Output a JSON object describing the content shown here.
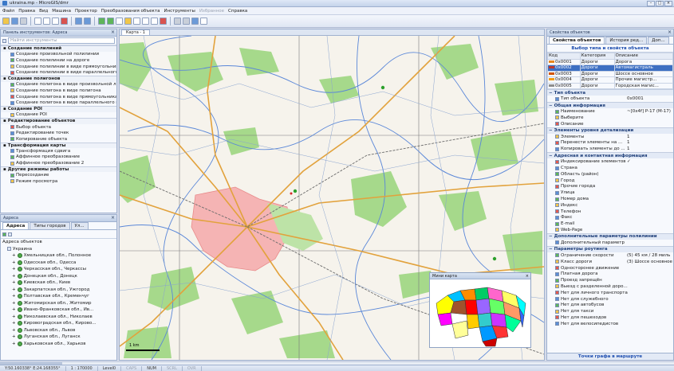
{
  "window": {
    "title": "ukraina.mp - MicroGIS/dmr",
    "buttons": [
      "–",
      "□",
      "×"
    ]
  },
  "menu": [
    {
      "label": "Файл",
      "disabled": false
    },
    {
      "label": "Правка",
      "disabled": false
    },
    {
      "label": "Вид",
      "disabled": false
    },
    {
      "label": "Машина",
      "disabled": false
    },
    {
      "label": "Проектор",
      "disabled": false
    },
    {
      "label": "Преобразования объекта",
      "disabled": false
    },
    {
      "label": "Инструменты",
      "disabled": false
    },
    {
      "label": "Избранное",
      "disabled": true
    },
    {
      "label": "Справка",
      "disabled": false
    }
  ],
  "left_panel": {
    "header": "Панель инструментов: Адреса",
    "search_placeholder": "Найти инструменты",
    "sections": [
      {
        "title": "Создание полилиний",
        "items": [
          "Создание произвольной полилинии",
          "Создание полилинии на дороге",
          "Создание полилинии в виде прямоугольника",
          "Создание полилинии в виде параллельного прям..."
        ]
      },
      {
        "title": "Создание полигонов",
        "items": [
          "Создание полигона в виде произвольной линии",
          "Создание полигона в виде полигона",
          "Создание полигона в виде прямоугольника",
          "Создание полигона в виде параллельного пря..."
        ]
      },
      {
        "title": "Создание POI",
        "items": [
          "Создание POI"
        ]
      },
      {
        "title": "Редактирование объектов",
        "items": [
          "Выбор объекта",
          "Редактирование точек",
          "Копирование объекта"
        ]
      },
      {
        "title": "Трансформация карты",
        "items": [
          "Трансформация сдвига",
          "Аффинное преобразование",
          "Аффинное преобразование 2"
        ]
      },
      {
        "title": "Другие режимы работы",
        "items": [
          "Пересоздание",
          "Режим просмотра"
        ]
      }
    ]
  },
  "address_panel": {
    "header": "Адреса",
    "tabs": [
      "Адреса",
      "Типы городов",
      "Ул..."
    ],
    "tree_root": "Адреса объектов",
    "tree_sub": "Украина",
    "regions": [
      "Хмельницкая обл., Полонное",
      "Одесская обл., Одесса",
      "Черкасская обл., Черкассы",
      "Донецкая обл., Донецк",
      "Киевская обл., Киев",
      "Закарпатская обл., Ужгород",
      "Полтавская обл., Кременчуг",
      "Житомирская обл., Житомир",
      "Ивано-Франковская обл., Ив...",
      "Николаевская обл., Николаев",
      "Кировоградская обл., Кирово...",
      "Львовская обл., Львов",
      "Луганская обл., Луганск",
      "Харьковская обл., Харьков"
    ]
  },
  "map": {
    "tab": "Карта - 1",
    "scale_label": "1 km",
    "minimap_title": "Мини карта"
  },
  "right_panel": {
    "tabs": [
      "Свойства объектов",
      "История ред...",
      "Доп..."
    ],
    "title": "Выбор типа и свойств объекта",
    "columns": [
      "Код",
      "Категория",
      "Описание"
    ],
    "rows": [
      {
        "code": "0x0001",
        "category": "Дороги",
        "desc": "Дорога",
        "color": "#e8871e",
        "sel": false
      },
      {
        "code": "0x0002",
        "category": "Дороги",
        "desc": "Автомагистраль",
        "color": "#c0392b",
        "sel": true
      },
      {
        "code": "0x0003",
        "category": "Дороги",
        "desc": "Шоссе основное",
        "color": "#d35400",
        "sel": false
      },
      {
        "code": "0x0004",
        "category": "Дороги",
        "desc": "Прочие магистр...",
        "color": "#f39c12",
        "sel": false
      },
      {
        "code": "0x0005",
        "category": "Дороги",
        "desc": "Городская магис...",
        "color": "#8e8e8e",
        "sel": false
      }
    ],
    "groups": [
      {
        "title": "Тип объекта",
        "rows": [
          {
            "label": "Тип объекта",
            "value": "0x0001"
          }
        ]
      },
      {
        "title": "Общая информация",
        "rows": [
          {
            "label": "Наименование",
            "value": "~[0x4f] Р-17 (М-17)"
          },
          {
            "label": "Выберите",
            "value": ""
          },
          {
            "label": "Описание",
            "value": ""
          }
        ]
      },
      {
        "title": "Элементы уровня детализации",
        "rows": [
          {
            "label": "Элементы",
            "value": "1"
          },
          {
            "label": "Перенести элементы на ...",
            "value": "1"
          },
          {
            "label": "Копировать элементы до ...",
            "value": "1"
          }
        ]
      },
      {
        "title": "Адресная и контактная информация",
        "rows": [
          {
            "label": "Индексирование элементов",
            "value": "✓"
          },
          {
            "label": "Страна",
            "value": ""
          },
          {
            "label": "Область (район)",
            "value": ""
          },
          {
            "label": "Город",
            "value": ""
          },
          {
            "label": "Прочие города",
            "value": ""
          },
          {
            "label": "Улица",
            "value": ""
          },
          {
            "label": "Номер дома",
            "value": ""
          },
          {
            "label": "Индекс",
            "value": ""
          },
          {
            "label": "Телефон",
            "value": ""
          },
          {
            "label": "Факс",
            "value": ""
          },
          {
            "label": "E-mail",
            "value": ""
          },
          {
            "label": "Web-Page",
            "value": ""
          }
        ]
      },
      {
        "title": "Дополнительные параметры полилинии",
        "rows": [
          {
            "label": "Дополнительный параметр",
            "value": ""
          }
        ]
      },
      {
        "title": "Параметры роутинга",
        "rows": [
          {
            "label": "Ограничение скорости",
            "value": "(5) 45 км / 28 миль"
          },
          {
            "label": "Класс дороги",
            "value": "(3) Шоссе основное"
          },
          {
            "label": "Односторонее движение",
            "value": ""
          },
          {
            "label": "Платная дорога",
            "value": ""
          },
          {
            "label": "Проезд запрещён",
            "value": ""
          },
          {
            "label": "Выезд с разделенной доро...",
            "value": ""
          },
          {
            "label": "Нет для личного транспорта",
            "value": ""
          },
          {
            "label": "Нет для служебного",
            "value": ""
          },
          {
            "label": "Нет для автобусов",
            "value": ""
          },
          {
            "label": "Нет для такси",
            "value": ""
          },
          {
            "label": "Нет для пешеходов",
            "value": ""
          },
          {
            "label": "Нет для велосипедистов",
            "value": ""
          }
        ]
      }
    ],
    "footer": "Точки графа в маршруте"
  },
  "status": [
    {
      "label": "Y:50.160338° E:24.168355°",
      "disabled": false
    },
    {
      "label": "1 : 170000",
      "disabled": false
    },
    {
      "label": "Level0",
      "disabled": false
    },
    {
      "label": "CAPS",
      "disabled": true
    },
    {
      "label": "NUM",
      "disabled": false
    },
    {
      "label": "SCRL",
      "disabled": true
    },
    {
      "label": "OVR",
      "disabled": true
    }
  ]
}
